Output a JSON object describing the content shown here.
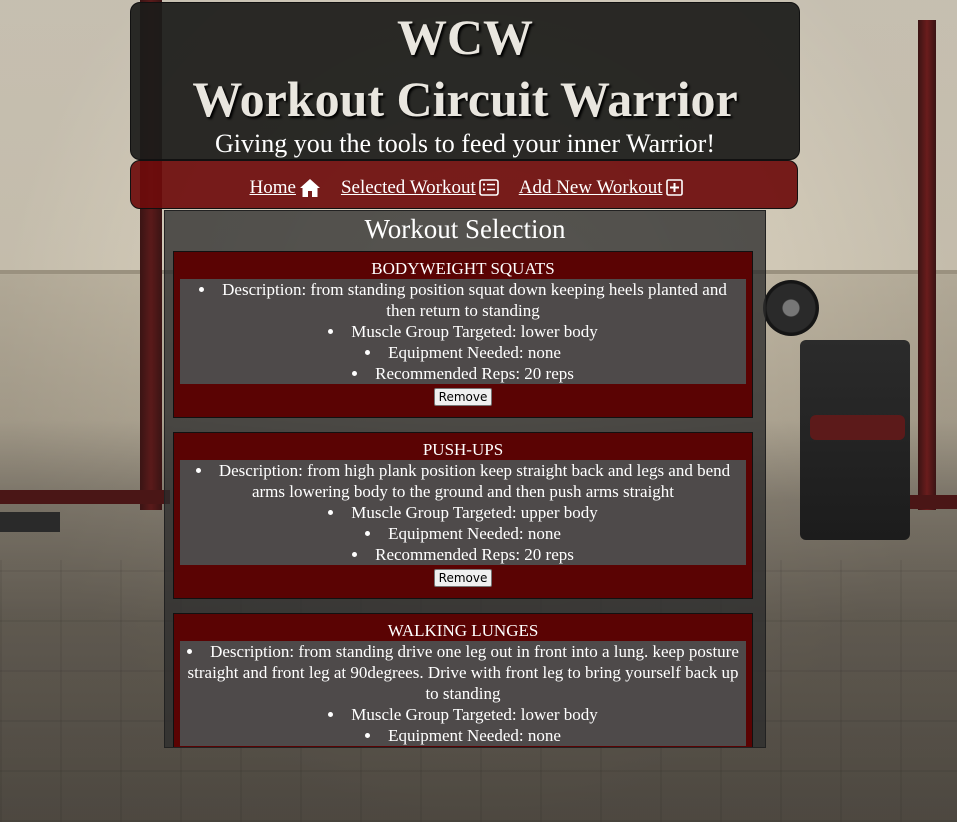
{
  "header": {
    "logo_short": "WCW",
    "logo_long": "Workout Circuit Warrior",
    "tagline": "Giving you the tools to feed your inner Warrior!"
  },
  "nav": {
    "items": [
      {
        "label": "Home ",
        "icon": "home-icon"
      },
      {
        "label": "Selected Workout ",
        "icon": "list-icon"
      },
      {
        "label": "Add New Workout ",
        "icon": "plus-square-icon"
      }
    ]
  },
  "main": {
    "title": "Workout Selection",
    "workouts": [
      {
        "name": "BODYWEIGHT SQUATS",
        "description": "Description: from standing position squat down keeping heels planted and then return to standing",
        "muscle": "Muscle Group Targeted: lower body",
        "equipment": "Equipment Needed: none",
        "reps": "Recommended Reps: 20 reps",
        "remove_label": "Remove"
      },
      {
        "name": "PUSH-UPS",
        "description": "Description: from high plank position keep straight back and legs and bend arms lowering body to the ground and then push arms straight",
        "muscle": "Muscle Group Targeted: upper body",
        "equipment": "Equipment Needed: none",
        "reps": "Recommended Reps: 20 reps",
        "remove_label": "Remove"
      },
      {
        "name": "WALKING LUNGES",
        "description": "Description: from standing drive one leg out in front into a lung. keep posture straight and front leg at 90degrees. Drive with front leg to bring yourself back up to standing",
        "muscle": "Muscle Group Targeted: lower body",
        "equipment": "Equipment Needed: none"
      }
    ]
  },
  "colors": {
    "header_bg": "#1c1c1a",
    "nav_bg": "#6e0c0c",
    "card_bg": "#5a0303",
    "details_bg": "#4e4a4a"
  }
}
